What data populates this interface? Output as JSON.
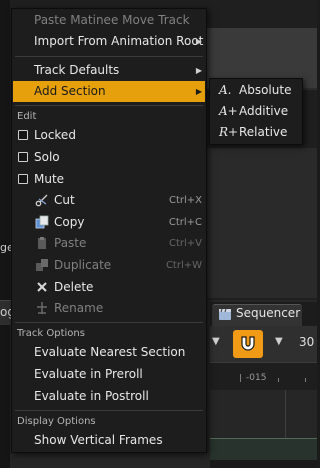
{
  "background": {
    "left_text": "ger",
    "left_tab_text": "og",
    "sequencer_tab": "Sequencer",
    "toolbar_number": "30",
    "ruler_label": "-015"
  },
  "menu": {
    "paste_matinee": "Paste Matinee Move Track",
    "import_anim_root": "Import From Animation Root",
    "track_defaults": "Track Defaults",
    "add_section": "Add Section",
    "edit_header": "Edit",
    "locked": "Locked",
    "solo": "Solo",
    "mute": "Mute",
    "cut": "Cut",
    "cut_shortcut": "Ctrl+X",
    "copy": "Copy",
    "copy_shortcut": "Ctrl+C",
    "paste": "Paste",
    "paste_shortcut": "Ctrl+V",
    "duplicate": "Duplicate",
    "duplicate_shortcut": "Ctrl+W",
    "delete": "Delete",
    "rename": "Rename",
    "track_options_header": "Track Options",
    "eval_nearest": "Evaluate Nearest Section",
    "eval_preroll": "Evaluate in Preroll",
    "eval_postroll": "Evaluate in Postroll",
    "display_options_header": "Display Options",
    "show_vertical_frames": "Show Vertical Frames"
  },
  "submenu": {
    "absolute": "Absolute",
    "absolute_icon": "A.",
    "additive": "Additive",
    "additive_icon": "A+",
    "relative": "Relative",
    "relative_icon": "R+"
  },
  "colors": {
    "highlight": "#e5a00b",
    "magnet_button": "#f09a15"
  }
}
